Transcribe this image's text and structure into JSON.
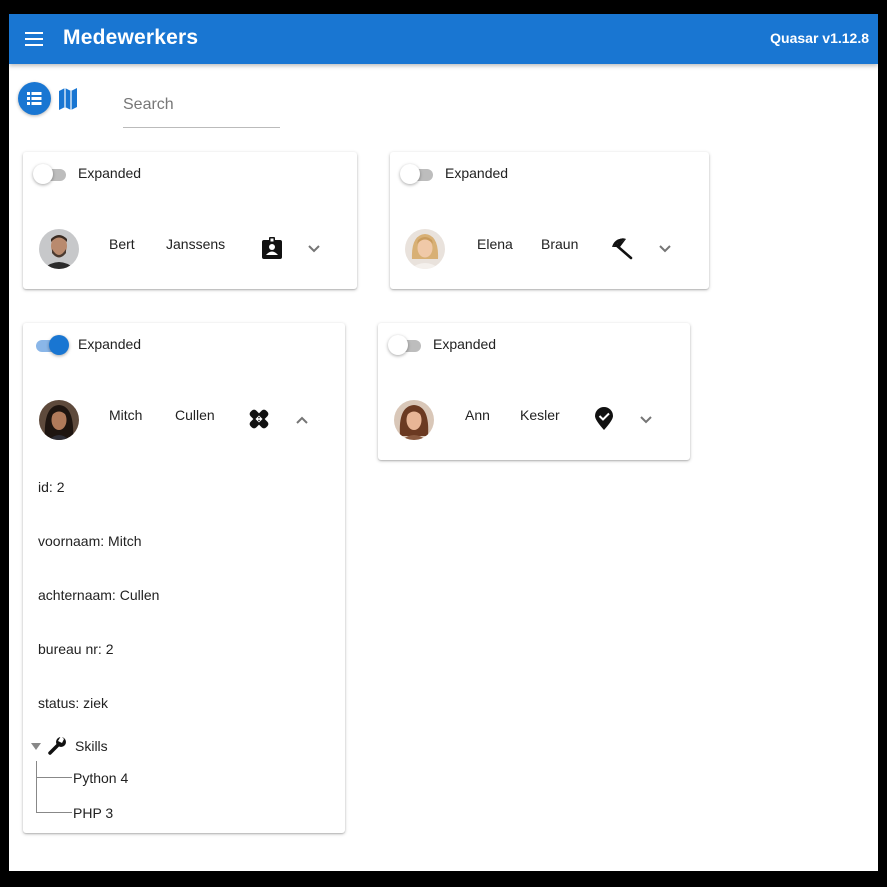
{
  "header": {
    "title": "Medewerkers",
    "version": "Quasar v1.12.8",
    "color": "#1976d2"
  },
  "toolbar": {
    "search_placeholder": "Search",
    "search_value": "",
    "view_list_icon": "list-icon",
    "view_map_icon": "map-icon"
  },
  "toggle_label": "Expanded",
  "cards": [
    {
      "firstname": "Bert",
      "lastname": "Janssens",
      "expanded": false,
      "status_icon": "badge-icon"
    },
    {
      "firstname": "Elena",
      "lastname": "Braun",
      "expanded": false,
      "status_icon": "beach-umbrella-icon"
    },
    {
      "firstname": "Mitch",
      "lastname": "Cullen",
      "expanded": true,
      "status_icon": "bandage-icon"
    },
    {
      "firstname": "Ann",
      "lastname": "Kesler",
      "expanded": false,
      "status_icon": "location-check-icon"
    }
  ],
  "details": {
    "id": {
      "label": "id:",
      "value": "2"
    },
    "voornaam": {
      "label": "voornaam:",
      "value": "Mitch"
    },
    "achternaam": {
      "label": "achternaam:",
      "value": "Cullen"
    },
    "bureau": {
      "label": "bureau nr:",
      "value": "2"
    },
    "status": {
      "label": "status:",
      "value": "ziek"
    }
  },
  "skills": {
    "label": "Skills",
    "items": [
      "Python 4",
      "PHP 3"
    ]
  }
}
